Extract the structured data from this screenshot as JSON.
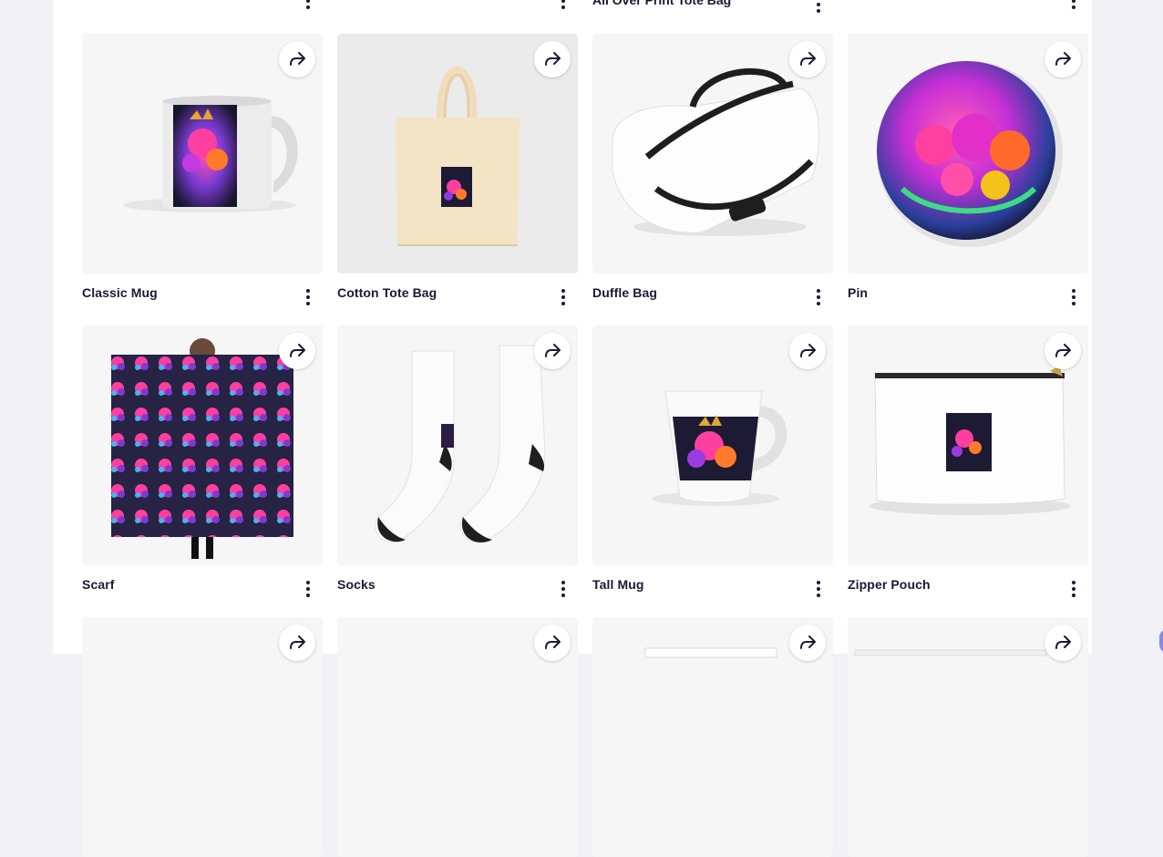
{
  "top_partial_row": {
    "visible_title": "All Over Print Tote Bag"
  },
  "products": [
    {
      "title": "Classic Mug",
      "image": "classic-mug"
    },
    {
      "title": "Cotton Tote Bag",
      "image": "cotton-tote-bag"
    },
    {
      "title": "Duffle Bag",
      "image": "duffle-bag"
    },
    {
      "title": "Pin",
      "image": "pin"
    },
    {
      "title": "Scarf",
      "image": "scarf"
    },
    {
      "title": "Socks",
      "image": "socks"
    },
    {
      "title": "Tall Mug",
      "image": "tall-mug"
    },
    {
      "title": "Zipper Pouch",
      "image": "zipper-pouch"
    }
  ],
  "icons": {
    "share": "share-arrow-icon",
    "more": "more-vertical-icon"
  },
  "colors": {
    "title_text": "#191934",
    "background": "#f1f1f6"
  }
}
